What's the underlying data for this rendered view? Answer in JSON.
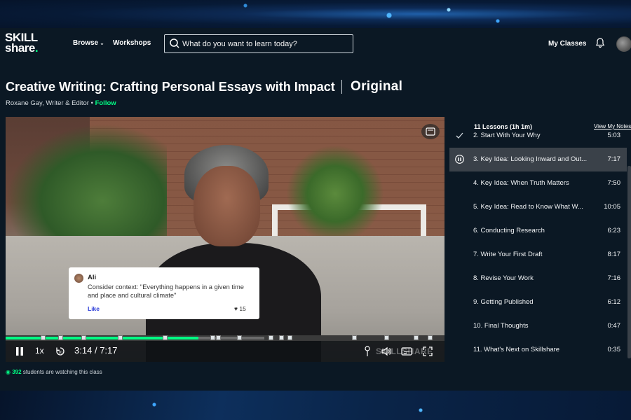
{
  "header": {
    "logo_line1": "SKILL",
    "logo_line2": "share",
    "logo_dot": ".",
    "browse_label": "Browse",
    "workshops_label": "Workshops",
    "search_placeholder": "What do you want to learn today?",
    "my_classes_label": "My Classes"
  },
  "class": {
    "title": "Creative Writing: Crafting Personal Essays with Impact",
    "badge": "Original",
    "teacher": "Roxane Gay, Writer & Editor",
    "separator": " • ",
    "follow_label": "Follow"
  },
  "video": {
    "comment": {
      "author": "Ali",
      "text": "Consider context: \"Everything happens in a given time and place and cultural climate\"",
      "like_label": "Like",
      "likes": "15"
    },
    "progress": 0.44,
    "buffered": 0.59,
    "speed": "1x",
    "current_time": "3:14",
    "time_separator": "/",
    "total_time": "7:17",
    "watermark": "SKILLSHARE"
  },
  "watching": {
    "count": "392",
    "text": "students are watching this class"
  },
  "lessons_panel": {
    "heading": "11 Lessons (1h 1m)",
    "notes_link": "View My Notes",
    "lessons": [
      {
        "title": "2. Start With Your Why",
        "duration": "5:03",
        "state": "done"
      },
      {
        "title": "3. Key Idea: Looking Inward and Out...",
        "duration": "7:17",
        "state": "playing"
      },
      {
        "title": "4. Key Idea: When Truth Matters",
        "duration": "7:50",
        "state": "none"
      },
      {
        "title": "5. Key Idea: Read to Know What W...",
        "duration": "10:05",
        "state": "none"
      },
      {
        "title": "6. Conducting Research",
        "duration": "6:23",
        "state": "none"
      },
      {
        "title": "7. Write Your First Draft",
        "duration": "8:17",
        "state": "none"
      },
      {
        "title": "8. Revise Your Work",
        "duration": "7:16",
        "state": "none"
      },
      {
        "title": "9. Getting Published",
        "duration": "6:12",
        "state": "none"
      },
      {
        "title": "10. Final Thoughts",
        "duration": "0:47",
        "state": "none"
      },
      {
        "title": "11. What's Next on Skillshare",
        "duration": "0:35",
        "state": "none"
      }
    ]
  },
  "colors": {
    "accent": "#00ff84",
    "background": "#0b1824",
    "active_row": "#3a4149",
    "link_blue": "#2a3bd8"
  },
  "icons": [
    "search-icon",
    "bell-icon",
    "chevron-down-icon",
    "pause-icon",
    "replay-10-icon",
    "pin-icon",
    "volume-icon",
    "captions-icon",
    "fullscreen-icon",
    "picture-in-picture-icon",
    "check-icon",
    "heart-icon",
    "eye-icon"
  ]
}
